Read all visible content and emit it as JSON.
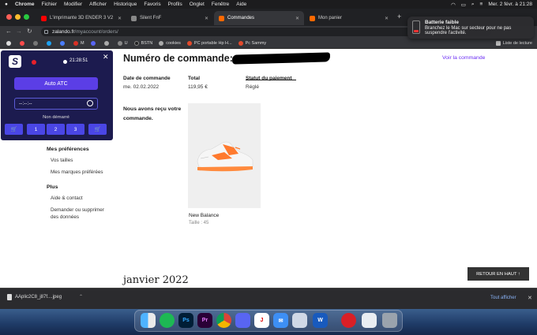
{
  "menubar": {
    "apple": "",
    "items": [
      "Chrome",
      "Fichier",
      "Modifier",
      "Afficher",
      "Historique",
      "Favoris",
      "Profils",
      "Onglet",
      "Fenêtre",
      "Aide"
    ],
    "datetime": "Mer. 2 févr. à 21:28"
  },
  "tabs": [
    {
      "label": "L'imprimante 3D ENDER 3 V2",
      "color": "#ff0000"
    },
    {
      "label": "Silent FnF",
      "color": "#888888"
    },
    {
      "label": "Commandes",
      "color": "#ff6900"
    },
    {
      "label": "Mon panier",
      "color": "#ff6900"
    }
  ],
  "address": {
    "host": "zalando.fr",
    "path": "/myaccount/orders/"
  },
  "bookmarks": [
    {
      "label": "M",
      "color": "#d93025"
    },
    {
      "label": "U",
      "color": "#888888"
    },
    {
      "label": "BSTN",
      "color": "#222222"
    },
    {
      "label": "cookies",
      "color": "#aaaaaa"
    },
    {
      "label": "PC portable Hp H...",
      "color": "#e34a2c"
    },
    {
      "label": "Pc Sammy",
      "color": "#e34a2c"
    }
  ],
  "reading_list": "Liste de lecture",
  "notification": {
    "title": "Batterie faible",
    "body": "Branchez le Mac sur secteur pour ne pas suspendre l'activité."
  },
  "order": {
    "title": "Numéro de commande:",
    "view_link": "Voir la commande",
    "date_label": "Date de commande",
    "date_value": "me. 02.02.2022",
    "total_label": "Total",
    "total_value": "119,95 €",
    "status_label": "Statut du paiement",
    "status_value": "Réglé",
    "received": "Nous avons reçu votre commande.",
    "product_name": "New Balance",
    "product_size": "Taille : 45"
  },
  "sidebar": {
    "prefs_heading": "Mes préférences",
    "prefs_items": [
      "Vos tailles",
      "Mes marques préférées"
    ],
    "more_heading": "Plus",
    "more_items": [
      "Aide & contact",
      "Demander ou supprimer",
      "des données"
    ]
  },
  "month": "janvier 2022",
  "back_to_top": "RETOUR EN HAUT ↑",
  "extension": {
    "logo": "S",
    "time": "21:28:51",
    "close": "✕",
    "auto_button": "Auto ATC",
    "time_input": "--:--:--",
    "status": "Non démarré",
    "buttons": [
      "1",
      "2",
      "3"
    ]
  },
  "downloads": {
    "file": "AAplic2C8_j87f....jpeg",
    "show_all": "Tout afficher",
    "close": "✕"
  },
  "dock": [
    "Finder",
    "Spotify",
    "Ps",
    "Pr",
    "Chrome",
    "Discord",
    "Mail",
    "Preview",
    "Word",
    "CC",
    "Files",
    "Trash"
  ]
}
